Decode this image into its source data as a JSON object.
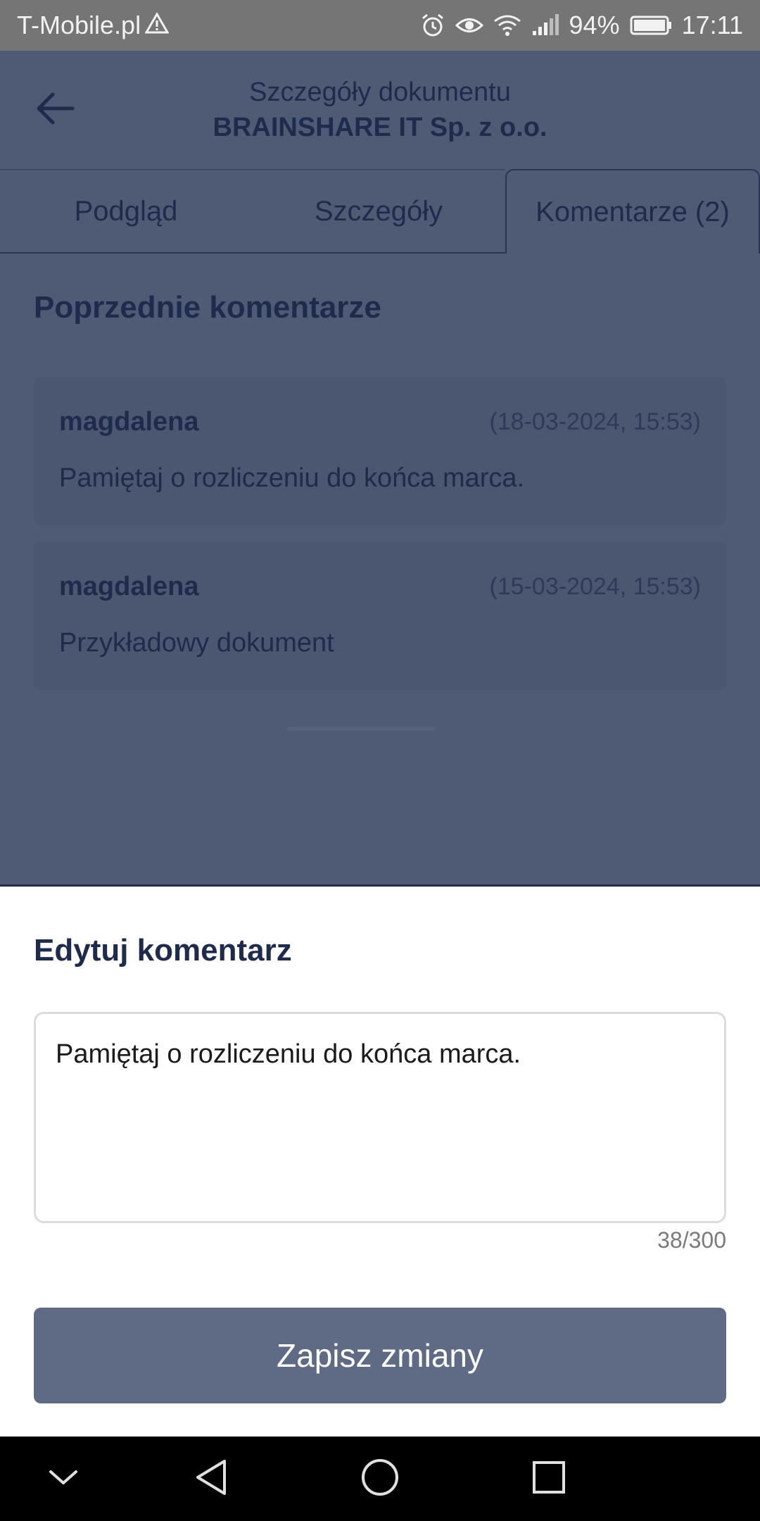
{
  "status_bar": {
    "carrier": "T-Mobile.pl",
    "battery_percent": "94%",
    "time": "17:11",
    "icons": [
      "warning-icon",
      "alarm-icon",
      "eye-icon",
      "wifi-icon",
      "signal-icon",
      "battery-icon"
    ]
  },
  "header": {
    "title": "Szczegóły dokumentu",
    "subtitle": "BRAINSHARE IT Sp. z o.o.",
    "back_icon": "arrow-left-icon"
  },
  "tabs": [
    {
      "label": "Podgląd"
    },
    {
      "label": "Szczegóły"
    },
    {
      "label": "Komentarze (2)",
      "active": true
    }
  ],
  "comments_section": {
    "title": "Poprzednie komentarze",
    "items": [
      {
        "author": "magdalena",
        "date": "(18-03-2024, 15:53)",
        "text": "Pamiętaj o rozliczeniu do końca marca."
      },
      {
        "author": "magdalena",
        "date": "(15-03-2024, 15:53)",
        "text": "Przykładowy dokument"
      }
    ]
  },
  "edit_sheet": {
    "title": "Edytuj komentarz",
    "textarea_value": "Pamiętaj o rozliczeniu do końca marca.",
    "counter": "38/300",
    "save_label": "Zapisz zmiany"
  },
  "nav_bar": {
    "icons": [
      "chevron-down-icon",
      "back-triangle-icon",
      "home-circle-icon",
      "recents-square-icon"
    ]
  },
  "colors": {
    "overlay_bg": "#4f5a75",
    "primary_text": "#1f2b4d",
    "button_bg": "#5f6a85",
    "status_bar_bg": "#757575"
  }
}
